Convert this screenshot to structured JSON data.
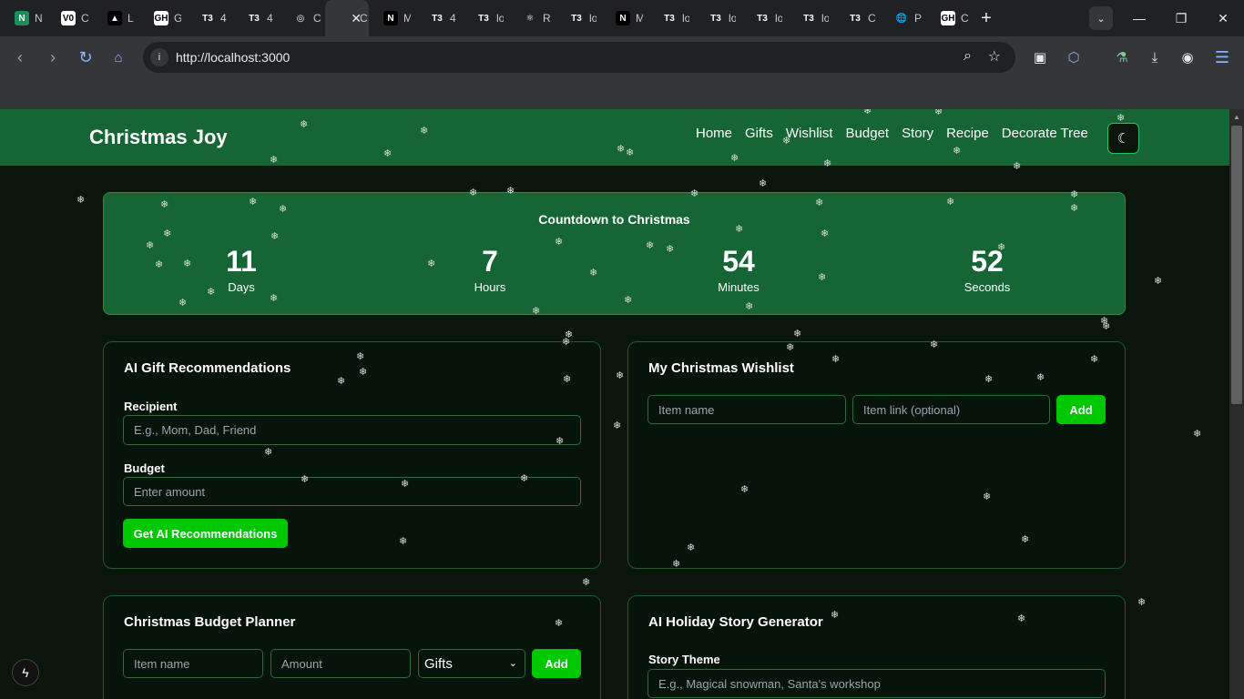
{
  "browser": {
    "tabs": [
      {
        "fav": "N",
        "label": "N",
        "color": "#1a8f5a"
      },
      {
        "fav": "V0",
        "label": "C",
        "color": "#ffffff"
      },
      {
        "fav": "▲",
        "label": "L",
        "color": "#000000"
      },
      {
        "fav": "GH",
        "label": "G",
        "color": "#ffffff"
      },
      {
        "fav": "T3",
        "label": "4",
        "color": "#202124"
      },
      {
        "fav": "T3",
        "label": "4",
        "color": "#202124"
      },
      {
        "fav": "◎",
        "label": "C",
        "color": "#202124"
      },
      {
        "fav": "",
        "label": "C",
        "color": "#35363a",
        "active": true
      },
      {
        "fav": "N",
        "label": "M",
        "color": "#000000"
      },
      {
        "fav": "T3",
        "label": "4",
        "color": "#202124"
      },
      {
        "fav": "T3",
        "label": "lo",
        "color": "#202124"
      },
      {
        "fav": "⚛",
        "label": "R",
        "color": "#202124"
      },
      {
        "fav": "T3",
        "label": "lo",
        "color": "#202124"
      },
      {
        "fav": "N",
        "label": "M",
        "color": "#000000"
      },
      {
        "fav": "T3",
        "label": "lo",
        "color": "#202124"
      },
      {
        "fav": "T3",
        "label": "lo",
        "color": "#202124"
      },
      {
        "fav": "T3",
        "label": "lo",
        "color": "#202124"
      },
      {
        "fav": "T3",
        "label": "lo",
        "color": "#202124"
      },
      {
        "fav": "T3",
        "label": "C",
        "color": "#202124"
      },
      {
        "fav": "🌐",
        "label": "P",
        "color": "#202124"
      },
      {
        "fav": "GH",
        "label": "C",
        "color": "#ffffff"
      }
    ],
    "url": "http://localhost:3000"
  },
  "site": {
    "brand": "Christmas Joy",
    "nav": [
      "Home",
      "Gifts",
      "Wishlist",
      "Budget",
      "Story",
      "Recipe",
      "Decorate Tree"
    ],
    "theme_icon": "moon-icon"
  },
  "countdown": {
    "title": "Countdown to Christmas",
    "units": [
      {
        "value": "11",
        "label": "Days"
      },
      {
        "value": "7",
        "label": "Hours"
      },
      {
        "value": "54",
        "label": "Minutes"
      },
      {
        "value": "52",
        "label": "Seconds"
      }
    ]
  },
  "gifts": {
    "title": "AI Gift Recommendations",
    "recipient_label": "Recipient",
    "recipient_placeholder": "E.g., Mom, Dad, Friend",
    "budget_label": "Budget",
    "budget_placeholder": "Enter amount",
    "button": "Get AI Recommendations"
  },
  "wishlist": {
    "title": "My Christmas Wishlist",
    "item_placeholder": "Item name",
    "link_placeholder": "Item link (optional)",
    "button": "Add"
  },
  "budget": {
    "title": "Christmas Budget Planner",
    "item_placeholder": "Item name",
    "amount_placeholder": "Amount",
    "category": "Gifts",
    "button": "Add"
  },
  "story": {
    "title": "AI Holiday Story Generator",
    "theme_label": "Story Theme",
    "theme_placeholder": "E.g., Magical snowman, Santa's workshop"
  },
  "colors": {
    "header": "#166534",
    "accent": "#00c800",
    "page_bg": "#0a160b"
  }
}
